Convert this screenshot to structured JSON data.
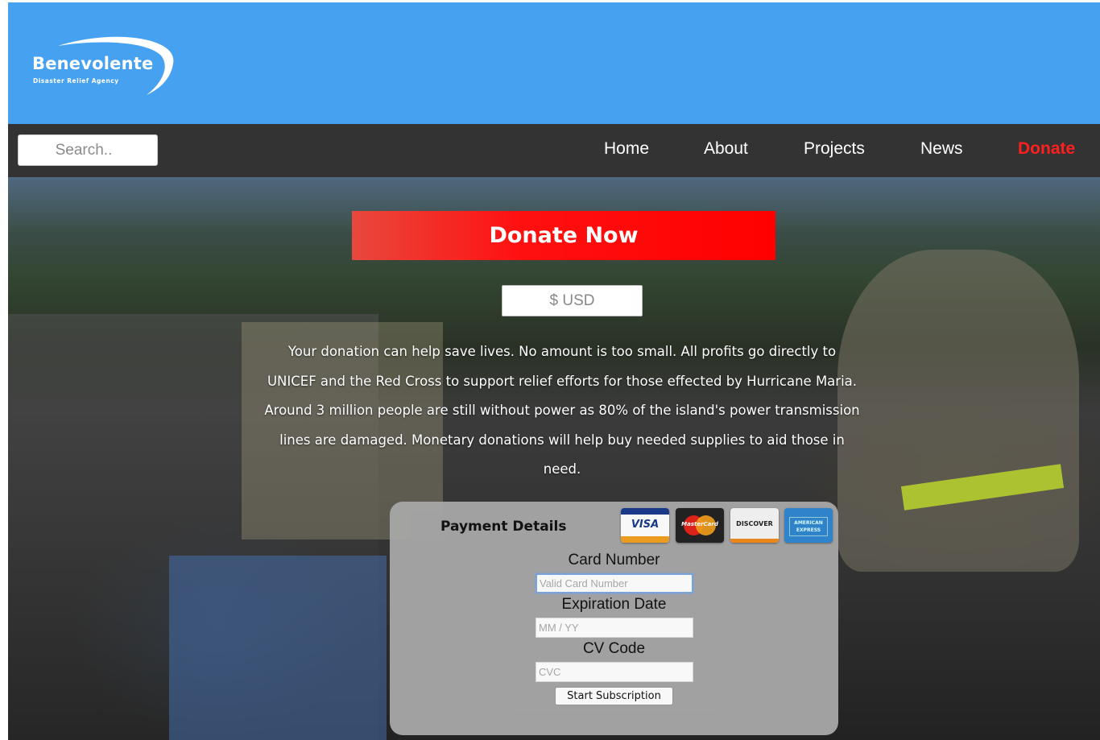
{
  "logo": {
    "title": "Benevolente",
    "subtitle": "Disaster Relief Agency"
  },
  "nav": {
    "search_placeholder": "Search..",
    "links": [
      {
        "label": "Home"
      },
      {
        "label": "About"
      },
      {
        "label": "Projects"
      },
      {
        "label": "News"
      },
      {
        "label": "Donate"
      }
    ],
    "donate_color": "#ff1f1f"
  },
  "hero": {
    "donate_button": "Donate Now",
    "amount_placeholder": "$ USD",
    "message": "Your donation can help save lives. No amount is too small. All profits go directly to UNICEF and the Red Cross to support relief efforts for those effected by Hurricane Maria. Around 3 million people are still without power as 80% of the island's power transmission lines are damaged. Monetary donations will help buy needed supplies to aid those in need."
  },
  "payment": {
    "title": "Payment Details",
    "cards": [
      {
        "name": "VISA",
        "icon": "visa-icon"
      },
      {
        "name": "MasterCard",
        "icon": "mastercard-icon"
      },
      {
        "name": "DISCOVER",
        "icon": "discover-icon"
      },
      {
        "name": "AMERICAN EXPRESS",
        "icon": "amex-icon"
      }
    ],
    "card_number_label": "Card Number",
    "card_number_placeholder": "Valid Card Number",
    "expiration_label": "Expiration Date",
    "expiration_placeholder": "MM / YY",
    "cv_label": "CV Code",
    "cv_placeholder": "CVC",
    "submit_label": "Start Subscription"
  },
  "colors": {
    "header_bg": "#46a2f0",
    "nav_bg": "#333333",
    "accent_red": "#ff0000",
    "panel_bg": "#a5a5a5"
  }
}
